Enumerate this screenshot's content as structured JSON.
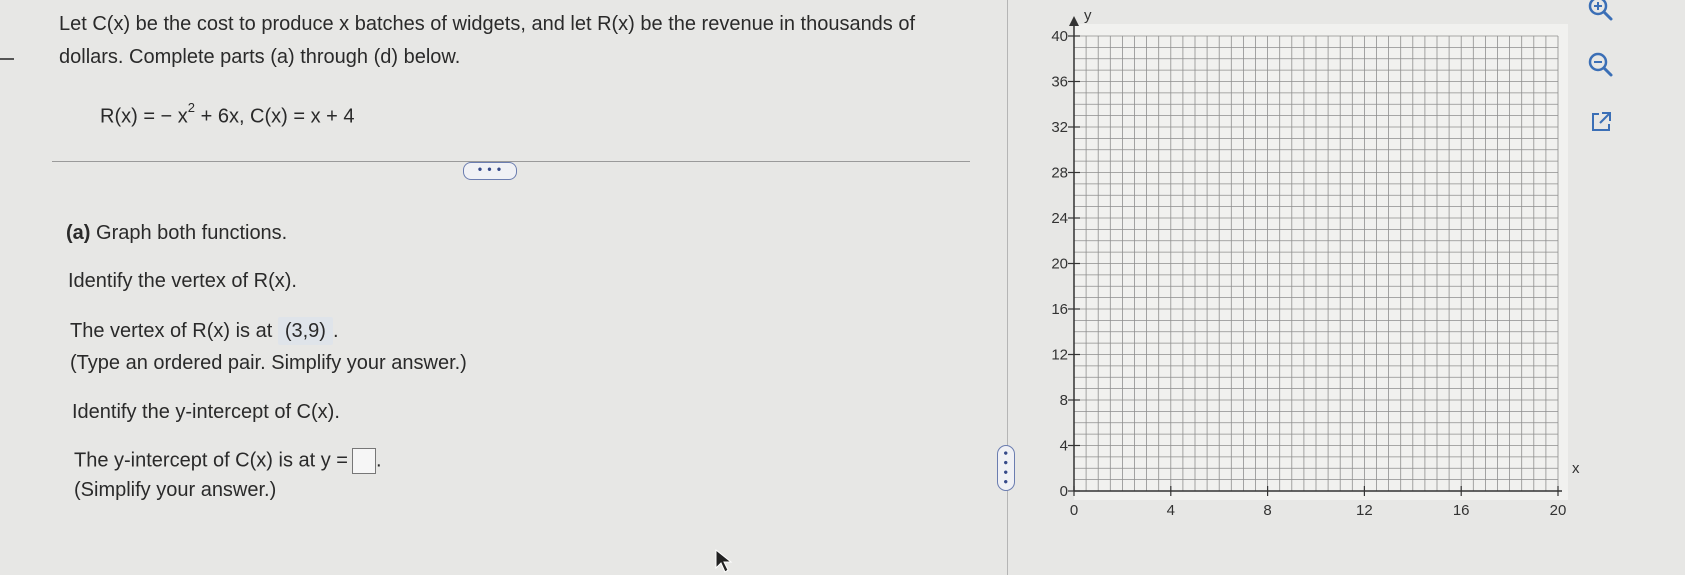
{
  "problem": {
    "intro_line1": "Let C(x) be the cost to produce x batches of widgets, and let R(x) be the revenue in thousands of",
    "intro_line2": "dollars. Complete parts (a) through (d) below.",
    "eq_R_prefix": "R(x) = − x",
    "eq_exponent": "2",
    "eq_rest": " + 6x, C(x) = x + 4",
    "more_label": "• • •"
  },
  "part_a": {
    "label": "(a)",
    "instruction": " Graph both functions.",
    "vertex_prompt": "Identify the vertex of R(x).",
    "vertex_answer_prefix": "The vertex of R(x) is at ",
    "vertex_answer_value": "(3,9)",
    "vertex_answer_suffix": ".",
    "vertex_hint": "(Type an ordered pair. Simplify your answer.)",
    "yint_prompt": "Identify the y-intercept of C(x).",
    "yint_answer_prefix": "The y-intercept of C(x) is at y =",
    "yint_answer_suffix": ".",
    "yint_hint": "(Simplify your answer.)"
  },
  "splitter": {
    "label": "• • • •"
  },
  "graph": {
    "x_axis_label": "x",
    "y_axis_label": "y",
    "x_ticks": [
      "0",
      "4",
      "8",
      "12",
      "16",
      "20"
    ],
    "y_ticks": [
      "0",
      "4",
      "8",
      "12",
      "16",
      "20",
      "24",
      "28",
      "32",
      "36",
      "40"
    ],
    "x_range": [
      0,
      20
    ],
    "y_range": [
      0,
      40
    ]
  },
  "tools": {
    "zoom_in_icon": "zoom-in-icon",
    "zoom_out_icon": "zoom-out-icon",
    "popout_icon": "popout-icon",
    "accent": "#3b6fb6"
  }
}
